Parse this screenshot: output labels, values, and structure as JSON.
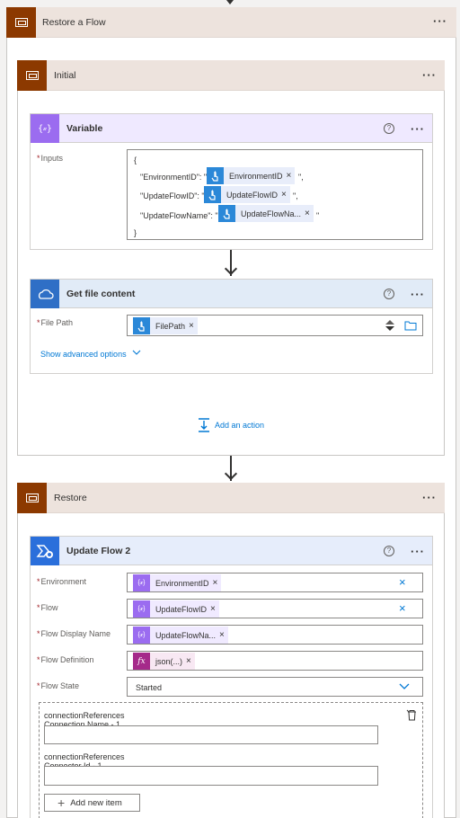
{
  "outer_scope": {
    "title": "Restore a Flow",
    "menu": "···"
  },
  "initial_scope": {
    "title": "Initial",
    "menu": "···"
  },
  "variable_card": {
    "title": "Variable",
    "help": "?",
    "menu": "···",
    "inputs_label": "Inputs",
    "required_mark": "*",
    "code_open": "{",
    "code_close": "}",
    "line1_key": "\"EnvironmentID\": \"",
    "line1_token": "EnvironmentID",
    "line1_end": "\",",
    "line2_key": "\"UpdateFlowID\": \"",
    "line2_token": "UpdateFlowID",
    "line2_end": "\",",
    "line3_key": "\"UpdateFlowName\": \"",
    "line3_token": "UpdateFlowNa...",
    "line3_end": "\"",
    "token_close": "×"
  },
  "file_card": {
    "title": "Get file content",
    "help": "?",
    "menu": "···",
    "filepath_label": "File Path",
    "filepath_token": "FilePath",
    "show_advanced": "Show advanced options",
    "token_close": "×"
  },
  "add_action": {
    "label": "Add an action"
  },
  "restore_scope": {
    "title": "Restore",
    "menu": "···"
  },
  "update_card": {
    "title": "Update Flow 2",
    "help": "?",
    "menu": "···",
    "token_close": "×",
    "clear": "×",
    "fields": {
      "environment_label": "Environment",
      "environment_token": "EnvironmentID",
      "flow_label": "Flow",
      "flow_token": "UpdateFlowID",
      "display_name_label": "Flow Display Name",
      "display_name_token": "UpdateFlowNa...",
      "definition_label": "Flow Definition",
      "definition_token": "json(...)",
      "state_label": "Flow State",
      "state_value": "Started"
    },
    "conn_refs": {
      "item1_label_line1": "connectionReferences",
      "item1_label_line2": "Connection Name - 1",
      "item2_label_line1": "connectionReferences",
      "item2_label_line2": "Connector Id - 1",
      "add_new_item": "Add new item"
    }
  },
  "colors": {
    "scope_icon": "#8c3900",
    "scope_header": "#ede3dd",
    "variable_header": "#efe9ff",
    "onedrive_header": "#e1ebf7",
    "powerautomate_header": "#e6edfb",
    "accent": "#0078d4"
  },
  "icons": [
    "scope-icon",
    "variable-icon",
    "onedrive-icon",
    "power-automate-management-icon",
    "help-icon",
    "ellipsis-icon",
    "chevron-down-icon",
    "clear-icon",
    "folder-icon",
    "delete-icon",
    "plus-icon",
    "arrow-down-icon"
  ]
}
